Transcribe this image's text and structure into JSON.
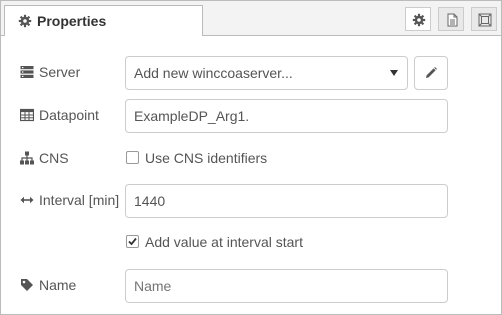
{
  "tabs": {
    "active_label": "Properties",
    "active_icon": "gear-icon",
    "buttons": [
      {
        "name": "node-settings-tab",
        "icon": "gear-icon"
      },
      {
        "name": "node-description-tab",
        "icon": "document-icon"
      },
      {
        "name": "node-appearance-tab",
        "icon": "frame-icon"
      }
    ]
  },
  "form": {
    "server": {
      "label": "Server",
      "icon": "server-icon",
      "value": "Add new winccoaserver..."
    },
    "datapoint": {
      "label": "Datapoint",
      "icon": "table-icon",
      "value": "ExampleDP_Arg1."
    },
    "cns": {
      "label": "CNS",
      "icon": "sitemap-icon",
      "checkbox_label": "Use CNS identifiers",
      "checked": false
    },
    "interval": {
      "label": "Interval [min]",
      "icon": "arrows-h-icon",
      "value": "1440"
    },
    "interval_start": {
      "checkbox_label": "Add value at interval start",
      "checked": true
    },
    "name": {
      "label": "Name",
      "icon": "tag-icon",
      "value": "",
      "placeholder": "Name"
    }
  }
}
